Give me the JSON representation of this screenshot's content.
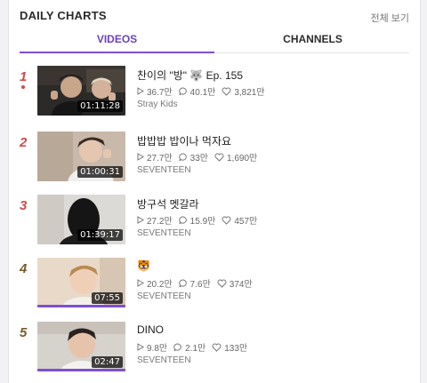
{
  "header": {
    "title": "DAILY CHARTS",
    "view_all": "전체 보기"
  },
  "tabs": [
    {
      "label": "VIDEOS",
      "active": true
    },
    {
      "label": "CHANNELS",
      "active": false
    }
  ],
  "colors": {
    "accent": "#7d4fd4",
    "rank": "#d04a4a"
  },
  "videos": [
    {
      "rank": "1",
      "title": "찬이의 \"방\" 🐺 Ep. 155",
      "views": "36.7만",
      "comments": "40.1만",
      "likes": "3,821만",
      "channel": "Stray Kids",
      "duration": "01:11:28",
      "progress": 0
    },
    {
      "rank": "2",
      "title": "밥밥밥 밥이나 먹자요",
      "views": "27.7만",
      "comments": "33만",
      "likes": "1,690만",
      "channel": "SEVENTEEN",
      "duration": "01:00:31",
      "progress": 0
    },
    {
      "rank": "3",
      "title": "방구석 멧갈라",
      "views": "27.2만",
      "comments": "15.9만",
      "likes": "457만",
      "channel": "SEVENTEEN",
      "duration": "01:39:17",
      "progress": 0
    },
    {
      "rank": "4",
      "title": "🐯",
      "views": "20.2만",
      "comments": "7.6만",
      "likes": "374만",
      "channel": "SEVENTEEN",
      "duration": "07:55",
      "progress": 1
    },
    {
      "rank": "5",
      "title": "DINO",
      "views": "9.8만",
      "comments": "2.1만",
      "likes": "133만",
      "channel": "SEVENTEEN",
      "duration": "02:47",
      "progress": 1
    }
  ]
}
